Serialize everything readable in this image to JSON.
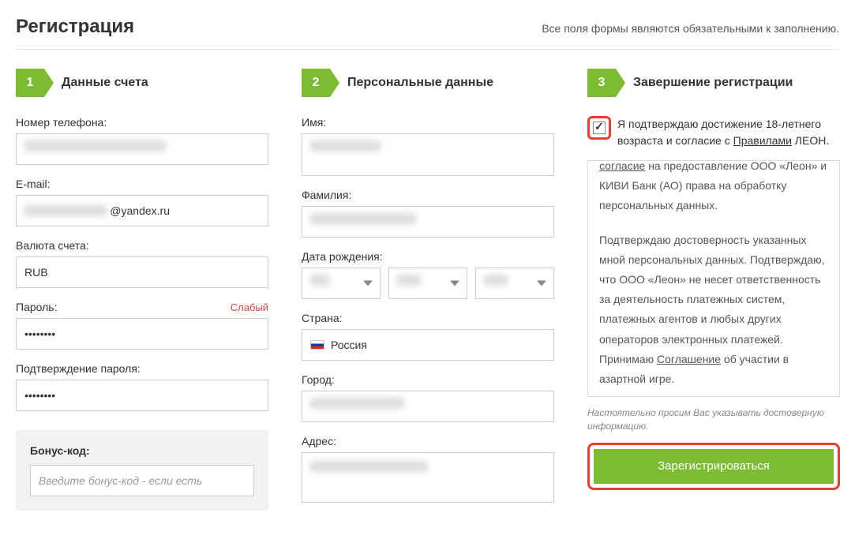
{
  "header": {
    "title": "Регистрация",
    "note": "Все поля формы являются обязательными к заполнению."
  },
  "step1": {
    "title": "Данные счета",
    "num": "1",
    "phone_label": "Номер телефона:",
    "email_label": "E-mail:",
    "email_value": "@yandex.ru",
    "currency_label": "Валюта счета:",
    "currency_value": "RUB",
    "password_label": "Пароль:",
    "password_strength": "Слабый",
    "password_value": "••••••••",
    "password2_label": "Подтверждение пароля:",
    "password2_value": "••••••••",
    "bonus_label": "Бонус-код:",
    "bonus_placeholder": "Введите бонус-код - если есть"
  },
  "step2": {
    "title": "Персональные данные",
    "num": "2",
    "fname_label": "Имя:",
    "lname_label": "Фамилия:",
    "dob_label": "Дата рождения:",
    "country_label": "Страна:",
    "country_value": "Россия",
    "city_label": "Город:",
    "address_label": "Адрес:"
  },
  "step3": {
    "title": "Завершение регистрации",
    "num": "3",
    "agree_prefix": "Я подтверждаю достижение 18-летнего возраста и согласие с ",
    "agree_link": "Правилами",
    "agree_suffix": " ЛЕОН.",
    "terms_p1_a": "согласие",
    "terms_p1_b": " на предоставление ООО «Леон» и КИВИ Банк (АО) права на обработку персональных данных.",
    "terms_p2_a": "Подтверждаю достоверность указанных мной персональных данных. Подтверждаю, что ООО «Леон» не несет ответственность за деятельность платежных систем, платежных агентов и любых других операторов электронных платежей. Принимаю ",
    "terms_p2_link": "Соглашение",
    "terms_p2_b": " об участии в азартной игре.",
    "disclaimer": "Настоятельно просим Вас указывать достоверную информацию.",
    "submit": "Зарегистрироваться"
  }
}
